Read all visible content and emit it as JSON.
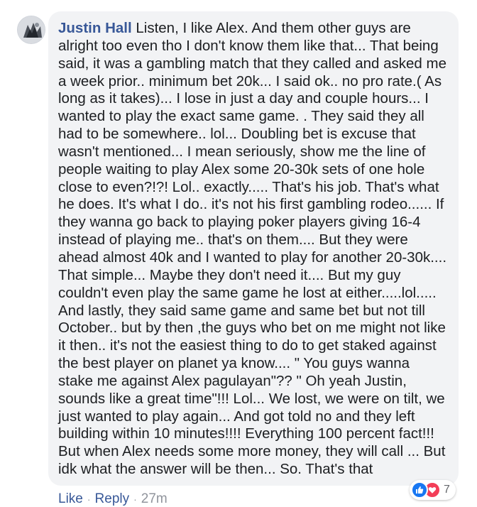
{
  "comment": {
    "author": "Justin Hall",
    "text": "Listen, I like Alex. And them other guys are alright too even tho I don't know them like that... That being said, it was a gambling match that they called and asked me a week prior.. minimum bet 20k... I said ok.. no pro rate.( As long as it takes)... I lose in just a day and couple hours... I wanted to play the exact same game. . They said they all had to be somewhere.. lol... Doubling bet is excuse that wasn't mentioned... I mean seriously, show me the line of people waiting to play Alex some 20-30k sets of one hole close to even?!?! Lol.. exactly..... That's his job. That's what he does. It's what I do.. it's not his first gambling rodeo...... If they wanna go back to playing poker players giving 16-4 instead of playing me.. that's on them.... But they were ahead almost 40k and I wanted to play for another 20-30k.... That simple... Maybe they don't need it.... But my guy couldn't even play the same game he lost at either.....lol..... And lastly, they said same game and same bet but not till October.. but by then ,the guys who bet on me might not like it then.. it's not the easiest thing to do to get staked against the best player on planet ya know.... \" You guys wanna stake me against Alex pagulayan\"?? \" Oh yeah Justin, sounds like a great time\"!!! Lol... We lost, we were on tilt, we just wanted to play again... And got told no and they left building within 10 minutes!!!! Everything 100 percent fact!!! But when Alex needs some more money, they will call ... But idk what the answer will be then... So. That's that"
  },
  "actions": {
    "like_label": "Like",
    "reply_label": "Reply",
    "separator": "·",
    "timestamp": "27m"
  },
  "reactions": {
    "icons": [
      "like-icon",
      "love-icon"
    ],
    "count": "7"
  },
  "colors": {
    "author": "#385898",
    "bubble": "#f2f3f5",
    "like": "#1877f2",
    "love": "#f33e58"
  }
}
